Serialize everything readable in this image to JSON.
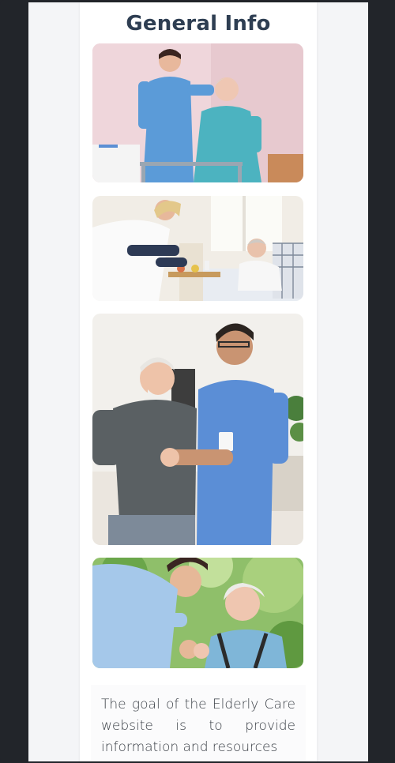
{
  "page": {
    "title": "General Info",
    "description": "The goal of the Elderly Care website is to provide information and resources"
  },
  "photos": [
    {
      "name": "nurse-helping-woman-with-walker-photo"
    },
    {
      "name": "nurse-serving-meal-in-bed-photo"
    },
    {
      "name": "nurse-walking-with-elderly-man-photo"
    },
    {
      "name": "nurse-holding-hands-elderly-woman-photo"
    }
  ],
  "colors": {
    "title": "#2e3e52",
    "scrubs": "#5b8fd4",
    "background_dark": "#22252a",
    "panel": "#f4f5f7"
  }
}
